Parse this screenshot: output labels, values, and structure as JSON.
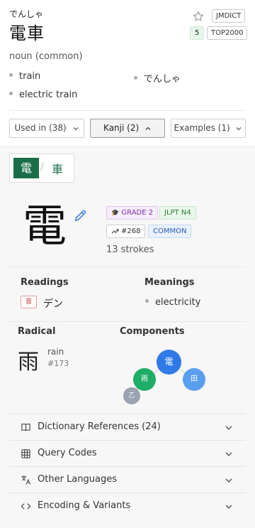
{
  "header": {
    "reading": "でんしゃ",
    "headword": "電車",
    "source_tag": "JMDICT",
    "priority_number": "5",
    "frequency_tag": "TOP2000"
  },
  "entry": {
    "pos": "noun (common)",
    "glosses_left": [
      "train",
      "electric train"
    ],
    "glosses_right": [
      "でんしゃ"
    ]
  },
  "tabs": [
    {
      "label": "Used in (38)",
      "chevron": "chevron-down-icon"
    },
    {
      "label": "Kanji (2)",
      "chevron": "chevron-up-icon"
    },
    {
      "label": "Examples (1)",
      "chevron": "chevron-down-icon"
    }
  ],
  "kanji_tabs": {
    "active": "電",
    "separator": "/",
    "other": "車"
  },
  "kanji": {
    "character": "電",
    "grade": "GRADE 2",
    "jlpt": "JLPT N4",
    "rank": "#268",
    "common": "COMMON",
    "strokes": "13 strokes"
  },
  "readings": {
    "title": "Readings",
    "on_badge": "音",
    "on_reading": "デン"
  },
  "meanings": {
    "title": "Meanings",
    "items": [
      "electricity"
    ]
  },
  "radical": {
    "title": "Radical",
    "character": "雨",
    "name": "rain",
    "number": "#173"
  },
  "components": {
    "title": "Components",
    "nodes": [
      {
        "char": "電",
        "color": "#2f7ae6"
      },
      {
        "char": "雨",
        "color": "#1fae68"
      },
      {
        "char": "田",
        "color": "#5a9ef0"
      },
      {
        "char": "乙",
        "color": "#9aa3b0"
      }
    ]
  },
  "accordions": [
    {
      "label": "Dictionary References (24)",
      "icon": "book-icon"
    },
    {
      "label": "Query Codes",
      "icon": "grid-icon"
    },
    {
      "label": "Other Languages",
      "icon": "translate-icon"
    },
    {
      "label": "Encoding & Variants",
      "icon": "code-icon"
    }
  ],
  "colors": {
    "accent_green": "#1a6e4a",
    "grade_purple": "#8a3fb8",
    "jlpt_green": "#2e7d32",
    "common_blue": "#2a5db0"
  }
}
